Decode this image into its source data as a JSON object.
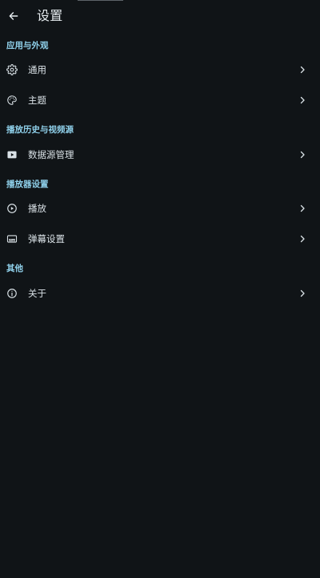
{
  "header": {
    "title": "设置"
  },
  "sections": [
    {
      "title": "应用与外观",
      "items": [
        {
          "label": "通用",
          "icon": "gear-icon"
        },
        {
          "label": "主题",
          "icon": "palette-icon"
        }
      ]
    },
    {
      "title": "播放历史与视频源",
      "items": [
        {
          "label": "数据源管理",
          "icon": "video-source-icon"
        }
      ]
    },
    {
      "title": "播放器设置",
      "items": [
        {
          "label": "播放",
          "icon": "play-circle-icon"
        },
        {
          "label": "弹幕设置",
          "icon": "subtitles-icon"
        }
      ]
    },
    {
      "title": "其他",
      "items": [
        {
          "label": "关于",
          "icon": "info-icon"
        }
      ]
    }
  ],
  "icons": {
    "back": "arrow-left-icon",
    "chevron": "chevron-right-icon"
  },
  "colors": {
    "background": "#101417",
    "accent": "#8fd0ea",
    "text": "#d9e1e6"
  }
}
